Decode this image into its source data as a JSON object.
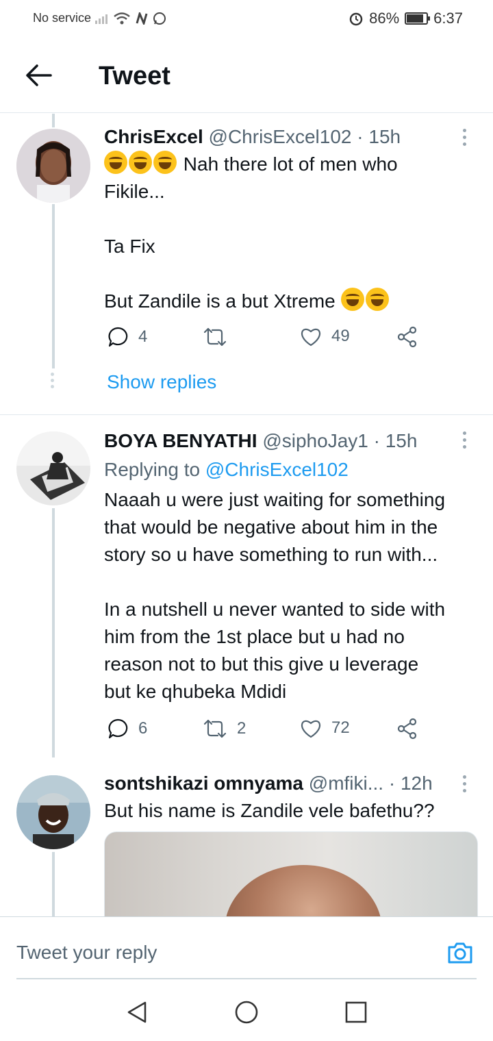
{
  "status_bar": {
    "carrier": "No service",
    "battery_percent": "86%",
    "time": "6:37"
  },
  "header": {
    "title": "Tweet"
  },
  "tweets": [
    {
      "name": "ChrisExcel",
      "handle": "@ChrisExcel102",
      "time": "· 15h",
      "text_line1": "Nah there lot of men who",
      "text_rest": "Fikile...\n\nTa Fix\n\nBut Zandile is a but Xtreme",
      "reply_count": "4",
      "retweet_count": "",
      "like_count": "49",
      "show_replies": "Show replies"
    },
    {
      "name": "BOYA BENYATHI",
      "handle": "@siphoJay1",
      "time": "· 15h",
      "replying_prefix": "Replying to",
      "replying_to": "@ChrisExcel102",
      "text": "Naaah u were just waiting for something\nthat would be negative about him in the\nstory so u have something to run with...\n\nIn a nutshell u never wanted to side with\nhim from the 1st place but u had no\nreason not to but this give u leverage\nbut ke qhubeka Mdidi",
      "reply_count": "6",
      "retweet_count": "2",
      "like_count": "72"
    },
    {
      "name": "sontshikazi omnyama",
      "handle": "@mfiki...",
      "time": "· 12h",
      "text": "But his name is Zandile vele bafethu??"
    }
  ],
  "reply_bar": {
    "placeholder": "Tweet your reply"
  },
  "colors": {
    "accent": "#1d9bf0",
    "secondary_text": "#536471",
    "divider": "#e1e8ed"
  }
}
